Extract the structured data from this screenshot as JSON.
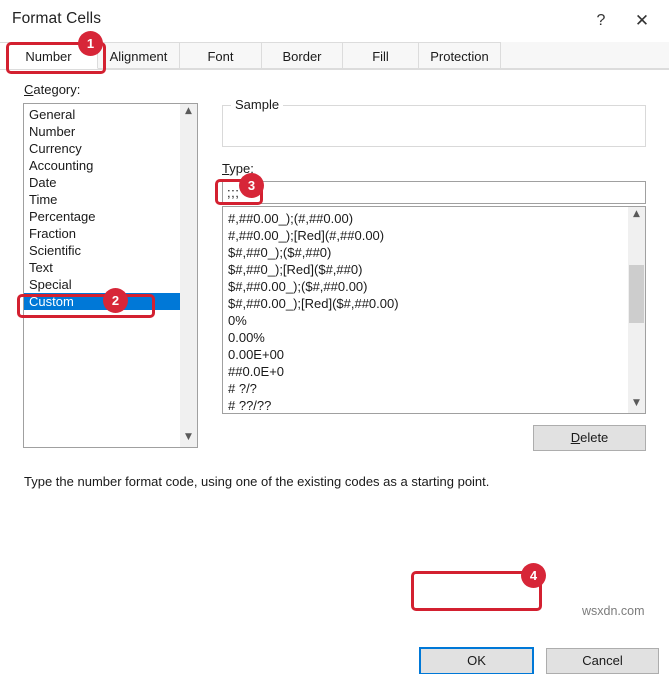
{
  "window": {
    "title": "Format Cells",
    "help_icon": "question-mark-icon",
    "help_label": "?",
    "close_label": "✕"
  },
  "tabs": [
    {
      "label": "Number",
      "active": true
    },
    {
      "label": "Alignment",
      "active": false
    },
    {
      "label": "Font",
      "active": false
    },
    {
      "label": "Border",
      "active": false
    },
    {
      "label": "Fill",
      "active": false
    },
    {
      "label": "Protection",
      "active": false
    }
  ],
  "category": {
    "label": "Category:",
    "items": [
      "General",
      "Number",
      "Currency",
      "Accounting",
      "Date",
      "Time",
      "Percentage",
      "Fraction",
      "Scientific",
      "Text",
      "Special",
      "Custom"
    ],
    "selected": "Custom"
  },
  "sample": {
    "legend": "Sample",
    "value": ""
  },
  "type": {
    "label": "Type:",
    "value": ";;;",
    "items": [
      "#,##0.00_);(#,##0.00)",
      "#,##0.00_);[Red](#,##0.00)",
      "$#,##0_);($#,##0)",
      "$#,##0_);[Red]($#,##0)",
      "$#,##0.00_);($#,##0.00)",
      "$#,##0.00_);[Red]($#,##0.00)",
      "0%",
      "0.00%",
      "0.00E+00",
      "##0.0E+0",
      "# ?/?",
      "# ??/??"
    ]
  },
  "buttons": {
    "delete": "Delete",
    "delete_accel": "D",
    "ok": "OK",
    "cancel": "Cancel"
  },
  "hint": "Type the number format code, using one of the existing codes as a starting point.",
  "annotations": [
    {
      "id": "1",
      "target": "tab-number"
    },
    {
      "id": "2",
      "target": "category-custom"
    },
    {
      "id": "3",
      "target": "type-input"
    },
    {
      "id": "4",
      "target": "ok-button"
    }
  ],
  "watermark": "wsxdn.com",
  "colors": {
    "accent": "#0078d7",
    "annotation": "#d32030",
    "badge": "#d72638"
  }
}
